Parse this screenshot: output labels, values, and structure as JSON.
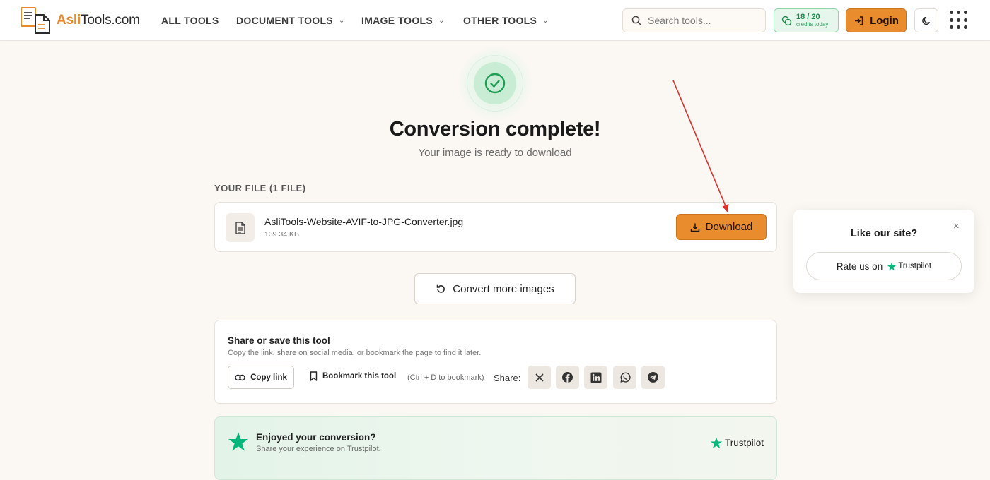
{
  "header": {
    "logo_accent": "Asli",
    "logo_rest": "Tools.com",
    "nav": [
      {
        "label": "ALL TOOLS",
        "has_dropdown": false
      },
      {
        "label": "DOCUMENT TOOLS",
        "has_dropdown": true
      },
      {
        "label": "IMAGE TOOLS",
        "has_dropdown": true
      },
      {
        "label": "OTHER TOOLS",
        "has_dropdown": true
      }
    ],
    "search_placeholder": "Search tools...",
    "credits_count": "18 / 20",
    "credits_label": "credits today",
    "login_label": "Login"
  },
  "hero": {
    "title": "Conversion complete!",
    "subtitle": "Your image is ready to download"
  },
  "files": {
    "section_label": "YOUR FILE (1 FILE)",
    "items": [
      {
        "name": "AsliTools-Website-AVIF-to-JPG-Converter.jpg",
        "size": "139.34 KB"
      }
    ],
    "download_label": "Download"
  },
  "convert_more_label": "Convert more images",
  "share": {
    "title": "Share or save this tool",
    "description": "Copy the link, share on social media, or bookmark the page to find it later.",
    "copy_link_label": "Copy link",
    "bookmark_label": "Bookmark this tool",
    "bookmark_hint": "(Ctrl + D to bookmark)",
    "share_label": "Share:",
    "networks": [
      "x-icon",
      "facebook-icon",
      "linkedin-icon",
      "whatsapp-icon",
      "telegram-icon"
    ]
  },
  "trustpilot_card": {
    "title": "Enjoyed your conversion?",
    "subtitle": "Share your experience on Trustpilot.",
    "logo_text": "Trustpilot"
  },
  "popup": {
    "title": "Like our site?",
    "rate_label": "Rate us on",
    "rate_brand": "Trustpilot",
    "close_symbol": "×"
  },
  "colors": {
    "accent": "#e98c2d",
    "success": "#1e9e55",
    "trustpilot_green": "#00b67a",
    "annotation_arrow": "#d9302c"
  }
}
